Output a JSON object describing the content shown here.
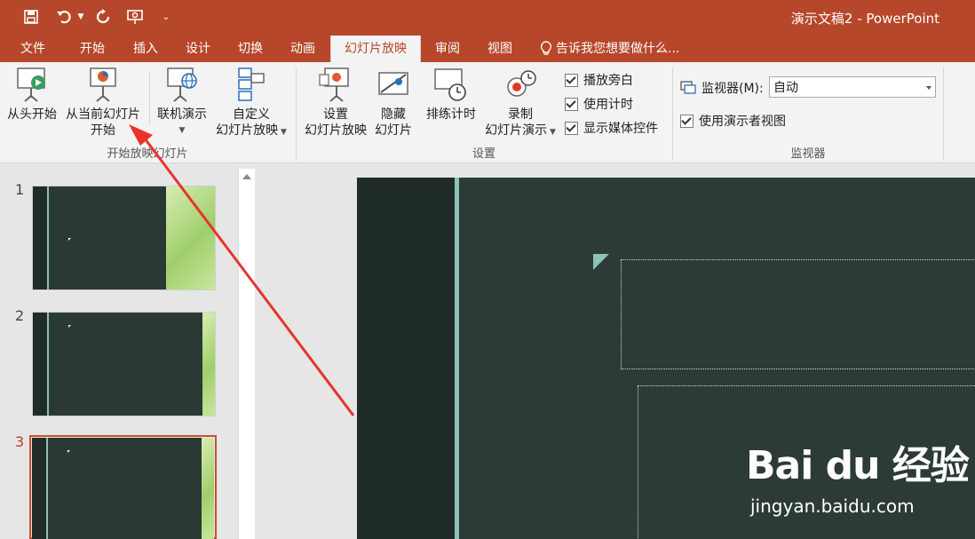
{
  "qat": {
    "save_icon": "save-icon",
    "undo_icon": "undo-icon",
    "redo_icon": "repeat-icon",
    "present_icon": "present-icon",
    "customize_icon": "customize-qat-icon"
  },
  "window": {
    "title": "演示文稿2 - PowerPoint"
  },
  "tabs": [
    {
      "label": "文件"
    },
    {
      "label": "开始"
    },
    {
      "label": "插入"
    },
    {
      "label": "设计"
    },
    {
      "label": "切换"
    },
    {
      "label": "动画"
    },
    {
      "label": "幻灯片放映"
    },
    {
      "label": "审阅"
    },
    {
      "label": "视图"
    }
  ],
  "tellme": {
    "label": "告诉我您想要做什么..."
  },
  "ribbon": {
    "start_group": {
      "label": "开始放映幻灯片",
      "from_beginning": "从头开始",
      "from_current_l1": "从当前幻灯片",
      "from_current_l2": "开始",
      "online": "联机演示",
      "custom_l1": "自定义",
      "custom_l2": "幻灯片放映"
    },
    "setup_group": {
      "label": "设置",
      "setup_l1": "设置",
      "setup_l2": "幻灯片放映",
      "hide_l1": "隐藏",
      "hide_l2": "幻灯片",
      "rehearse": "排练计时",
      "record_l1": "录制",
      "record_l2": "幻灯片演示",
      "cb_narration": "播放旁白",
      "cb_timings": "使用计时",
      "cb_media": "显示媒体控件"
    },
    "monitor_group": {
      "label": "监视器",
      "monitor_label": "监视器(M):",
      "monitor_value": "自动",
      "presenter_view": "使用演示者视图"
    }
  },
  "slides": [
    {
      "num": "1"
    },
    {
      "num": "2"
    },
    {
      "num": "3"
    }
  ],
  "watermark": {
    "logo": "Bai  du 经验",
    "url": "jingyan.baidu.com"
  },
  "colors": {
    "accent": "#b7472a",
    "slide_bg": "#2c3b35",
    "slide_accent": "#8cc2b8",
    "annotation_arrow": "#e8332c"
  }
}
